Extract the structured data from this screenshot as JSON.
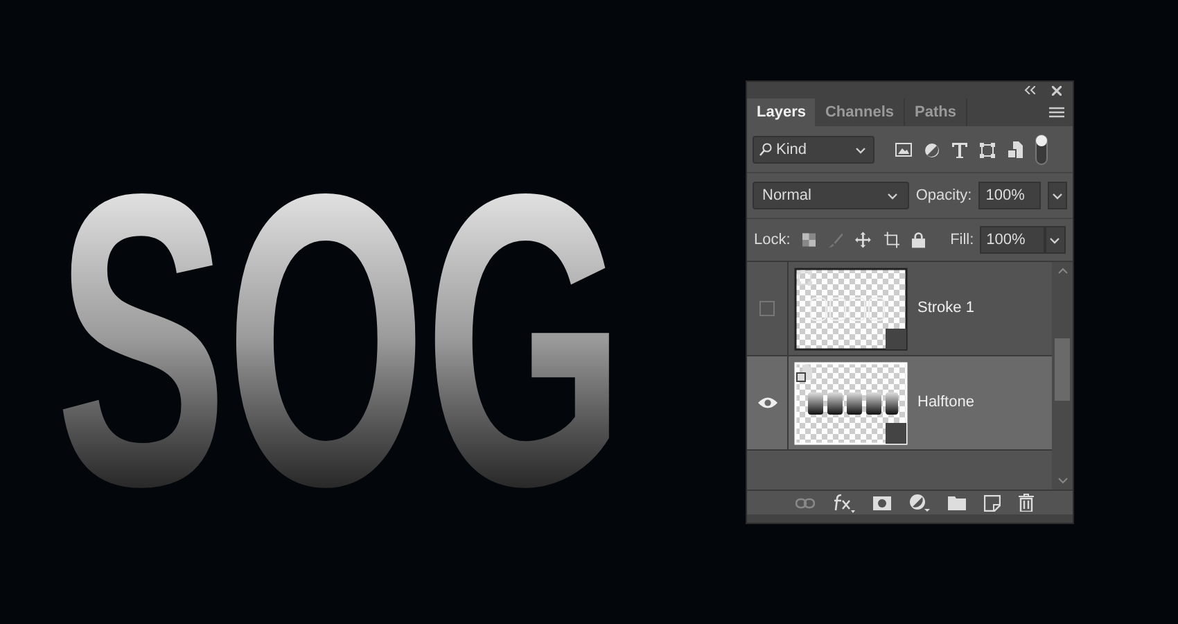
{
  "canvas_text": "SOG",
  "panel": {
    "tabs": [
      {
        "label": "Layers",
        "selected": true
      },
      {
        "label": "Channels",
        "selected": false
      },
      {
        "label": "Paths",
        "selected": false
      }
    ],
    "filter": {
      "value": "Kind"
    },
    "blend_mode": "Normal",
    "opacity_label": "Opacity:",
    "opacity": "100%",
    "lock_label": "Lock:",
    "fill_label": "Fill:",
    "fill": "100%",
    "layers": [
      {
        "name": "Stroke 1",
        "visible": false,
        "selected": false,
        "kind": "shape"
      },
      {
        "name": "Halftone",
        "visible": true,
        "selected": true,
        "kind": "smart"
      }
    ]
  }
}
